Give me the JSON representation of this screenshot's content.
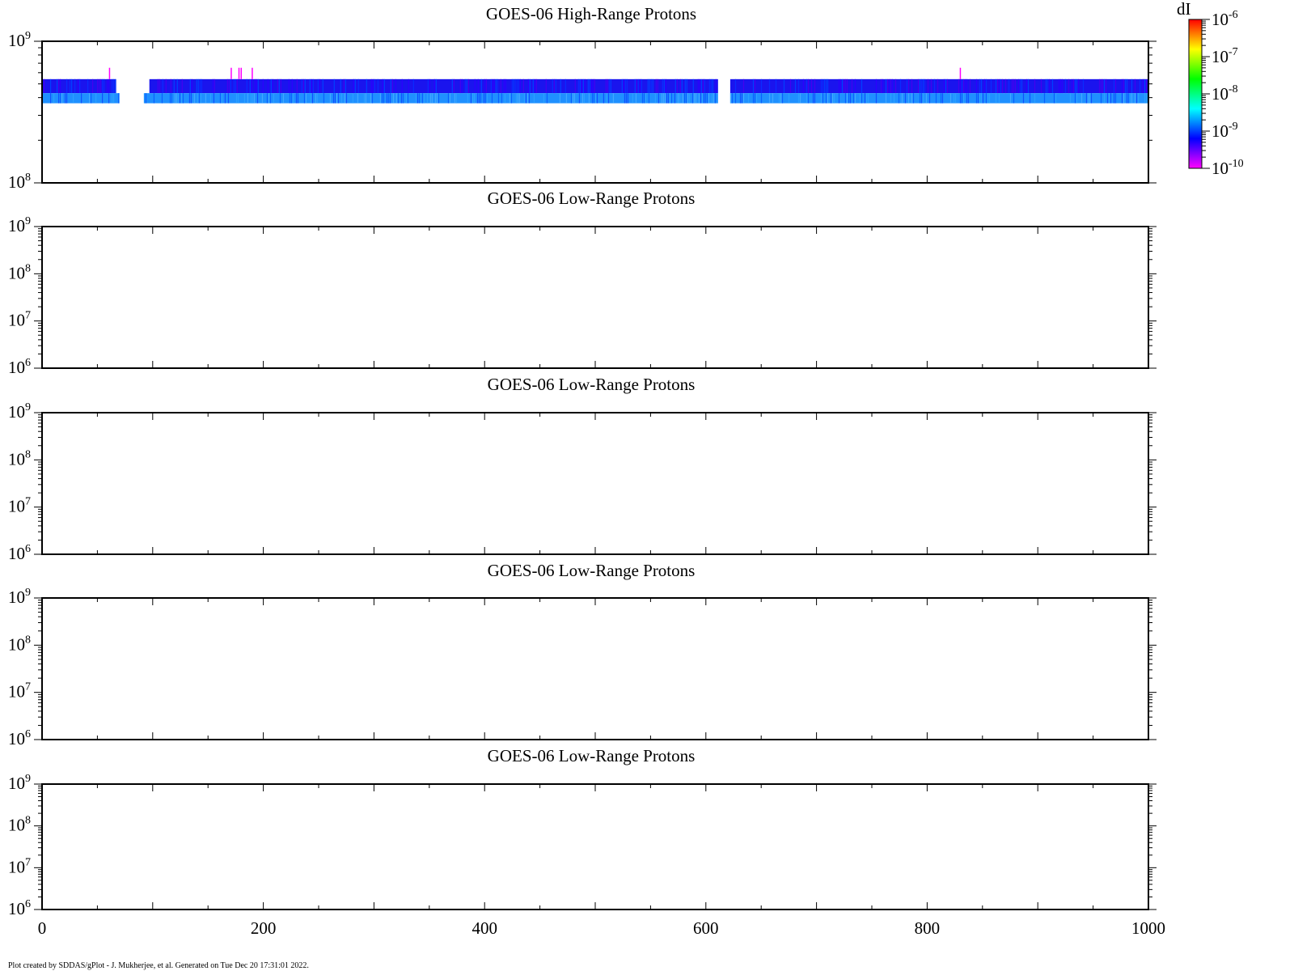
{
  "footer_text": "Plot created by SDDAS/gPlot - J. Mukherjee, et al.  Generated on Tue Dec 20 17:31:01 2022.",
  "colorbar": {
    "label": "dI",
    "ticks": [
      {
        "base": "10",
        "exp": "-6"
      },
      {
        "base": "10",
        "exp": "-7"
      },
      {
        "base": "10",
        "exp": "-8"
      },
      {
        "base": "10",
        "exp": "-9"
      },
      {
        "base": "10",
        "exp": "-10"
      }
    ],
    "range": [
      1e-10,
      1e-06
    ],
    "scale": "log",
    "colors": [
      "#ff00ff",
      "#8000ff",
      "#0000ff",
      "#0080ff",
      "#00ffff",
      "#00ff80",
      "#00ff00",
      "#80ff00",
      "#ffff00",
      "#ff8000",
      "#ff0000"
    ]
  },
  "chart_data": [
    {
      "type": "heatmap",
      "title": "GOES-06 High-Range Protons",
      "xlim": [
        0,
        1000
      ],
      "ylim": [
        100000000,
        1000000000
      ],
      "yscale": "log",
      "y_tick_labels": [
        {
          "base": "10",
          "exp": "9"
        },
        {
          "base": "10",
          "exp": "8"
        }
      ],
      "x_tick_labels": [],
      "bands": [
        {
          "y_range": [
            430000000,
            540000000
          ],
          "base_color": "#1a14ee",
          "alt_colors": [
            "#2c00ff",
            "#0a2cff",
            "#4400f0",
            "#0040ff"
          ],
          "segments": [
            [
              0,
              67
            ],
            [
              97,
              611
            ],
            [
              622,
              1000
            ]
          ]
        },
        {
          "y_range": [
            365000000,
            430000000
          ],
          "base_color": "#1f90ff",
          "alt_colors": [
            "#0a60ff",
            "#2aa0ff",
            "#1050ff",
            "#40a8ff"
          ],
          "segments": [
            [
              0,
              70
            ],
            [
              92,
              611
            ],
            [
              622,
              1000
            ]
          ]
        }
      ],
      "spikes": [
        {
          "x": 61,
          "y_range": [
            540000000,
            650000000
          ],
          "color": "#ff00ff"
        },
        {
          "x": 171,
          "y_range": [
            540000000,
            650000000
          ],
          "color": "#ff00ff"
        },
        {
          "x": 178,
          "y_range": [
            540000000,
            650000000
          ],
          "color": "#ff00ff"
        },
        {
          "x": 180,
          "y_range": [
            540000000,
            650000000
          ],
          "color": "#ff00ff"
        },
        {
          "x": 190,
          "y_range": [
            540000000,
            650000000
          ],
          "color": "#ff00ff"
        },
        {
          "x": 830,
          "y_range": [
            540000000,
            650000000
          ],
          "color": "#ff00ff"
        }
      ]
    },
    {
      "type": "heatmap",
      "title": "GOES-06 Low-Range Protons",
      "xlim": [
        0,
        1000
      ],
      "ylim": [
        1000000,
        1000000000
      ],
      "yscale": "log",
      "y_tick_labels": [
        {
          "base": "10",
          "exp": "9"
        },
        {
          "base": "10",
          "exp": "8"
        },
        {
          "base": "10",
          "exp": "7"
        },
        {
          "base": "10",
          "exp": "6"
        }
      ],
      "x_tick_labels": [],
      "bands": [],
      "spikes": []
    },
    {
      "type": "heatmap",
      "title": "GOES-06 Low-Range Protons",
      "xlim": [
        0,
        1000
      ],
      "ylim": [
        1000000,
        1000000000
      ],
      "yscale": "log",
      "y_tick_labels": [
        {
          "base": "10",
          "exp": "9"
        },
        {
          "base": "10",
          "exp": "8"
        },
        {
          "base": "10",
          "exp": "7"
        },
        {
          "base": "10",
          "exp": "6"
        }
      ],
      "x_tick_labels": [],
      "bands": [],
      "spikes": []
    },
    {
      "type": "heatmap",
      "title": "GOES-06 Low-Range Protons",
      "xlim": [
        0,
        1000
      ],
      "ylim": [
        1000000,
        1000000000
      ],
      "yscale": "log",
      "y_tick_labels": [
        {
          "base": "10",
          "exp": "9"
        },
        {
          "base": "10",
          "exp": "8"
        },
        {
          "base": "10",
          "exp": "7"
        },
        {
          "base": "10",
          "exp": "6"
        }
      ],
      "x_tick_labels": [],
      "bands": [],
      "spikes": []
    },
    {
      "type": "heatmap",
      "title": "GOES-06 Low-Range Protons",
      "xlim": [
        0,
        1000
      ],
      "ylim": [
        1000000,
        1000000000
      ],
      "yscale": "log",
      "y_tick_labels": [
        {
          "base": "10",
          "exp": "9"
        },
        {
          "base": "10",
          "exp": "8"
        },
        {
          "base": "10",
          "exp": "7"
        },
        {
          "base": "10",
          "exp": "6"
        }
      ],
      "x_tick_labels": [
        "0",
        "200",
        "400",
        "600",
        "800",
        "1000"
      ],
      "bands": [],
      "spikes": []
    }
  ]
}
